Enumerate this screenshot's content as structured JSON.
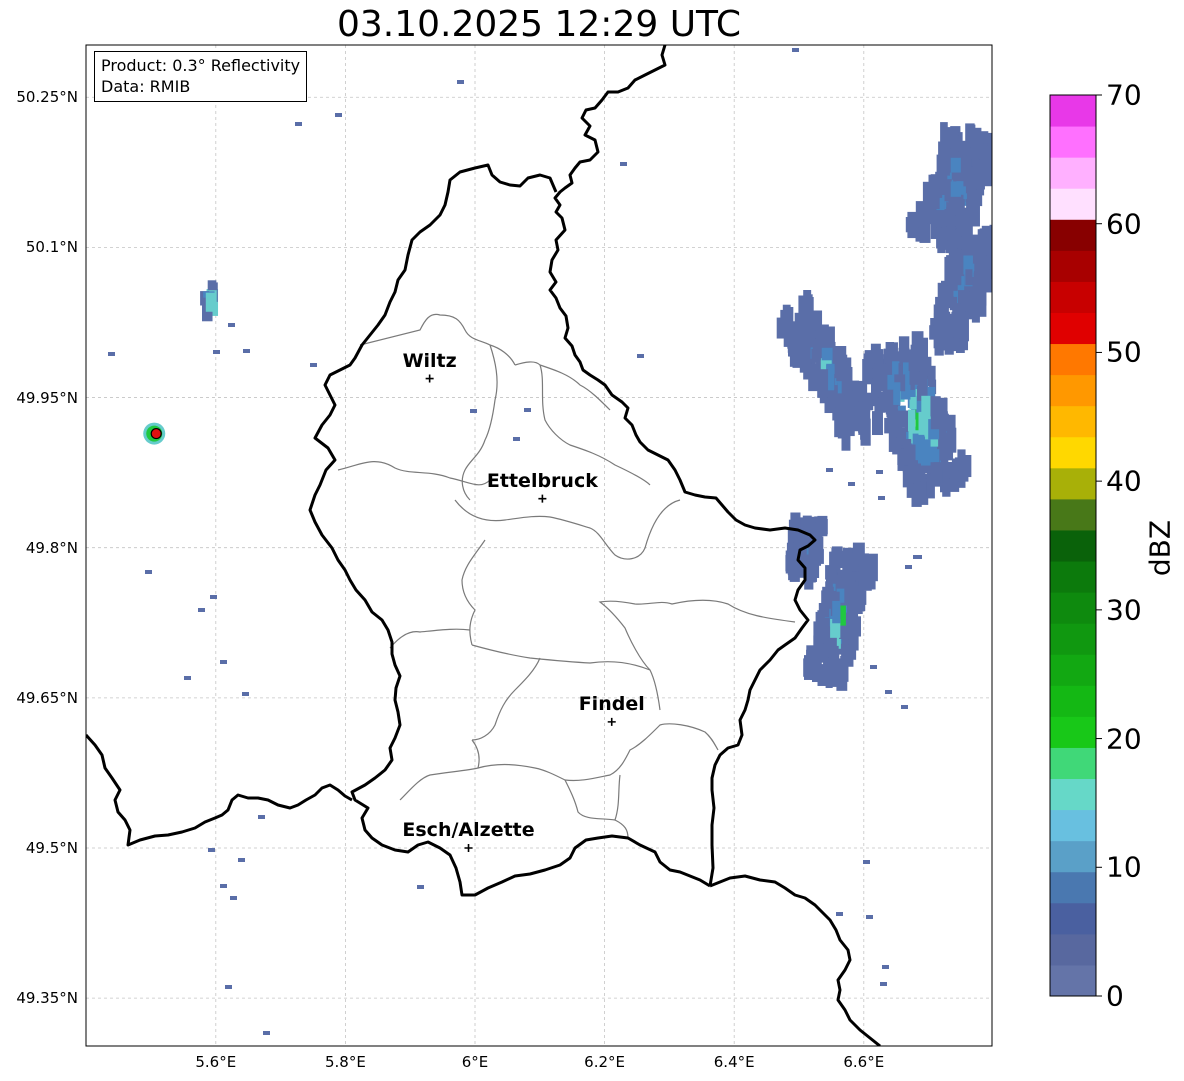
{
  "title": "03.10.2025 12:29 UTC",
  "info_box": {
    "product": "Product: 0.3° Reflectivity",
    "data_source": "Data: RMIB"
  },
  "latitude_labels": [
    {
      "lat": 50.25,
      "text": "50.25°N"
    },
    {
      "lat": 50.1,
      "text": "50.1°N"
    },
    {
      "lat": 49.95,
      "text": "49.95°N"
    },
    {
      "lat": 49.8,
      "text": "49.8°N"
    },
    {
      "lat": 49.65,
      "text": "49.65°N"
    },
    {
      "lat": 49.5,
      "text": "49.5°N"
    },
    {
      "lat": 49.35,
      "text": "49.35°N"
    }
  ],
  "longitude_labels": [
    {
      "lon": 5.6,
      "text": "5.6°E"
    },
    {
      "lon": 5.8,
      "text": "5.8°E"
    },
    {
      "lon": 6.0,
      "text": "6°E"
    },
    {
      "lon": 6.2,
      "text": "6.2°E"
    },
    {
      "lon": 6.4,
      "text": "6.4°E"
    },
    {
      "lon": 6.6,
      "text": "6.6°E"
    }
  ],
  "cities": [
    {
      "name": "Wiltz",
      "lon": 5.93,
      "lat": 49.969
    },
    {
      "name": "Ettelbruck",
      "lon": 6.104,
      "lat": 49.849
    },
    {
      "name": "Findel",
      "lon": 6.211,
      "lat": 49.626
    },
    {
      "name": "Esch/Alzette",
      "lon": 5.99,
      "lat": 49.5
    }
  ],
  "radar_site": {
    "lon": 5.505,
    "lat": 49.914
  },
  "colorbar": {
    "label": "dBZ",
    "min": 0,
    "max": 70,
    "ticks": [
      "0",
      "10",
      "20",
      "30",
      "40",
      "50",
      "60",
      "70"
    ],
    "colors": [
      "#6474a8",
      "#58689f",
      "#4a60a0",
      "#4a78b0",
      "#5aa0c8",
      "#68c0e0",
      "#66d8c8",
      "#40d878",
      "#18c818",
      "#14b814",
      "#12a812",
      "#109810",
      "#0e8a0e",
      "#0c7a0c",
      "#0a620a",
      "#487818",
      "#a8b008",
      "#ffd800",
      "#ffb800",
      "#ff9800",
      "#ff7800",
      "#e00000",
      "#c80000",
      "#a80000",
      "#880000",
      "#ffe0ff",
      "#ffb0ff",
      "#ff70ff",
      "#e838e8"
    ]
  },
  "echo_colors": {
    "weak": "#5a6ea8",
    "light": "#4a84c0",
    "moderate": "#66cccc",
    "strong": "#20c840"
  }
}
